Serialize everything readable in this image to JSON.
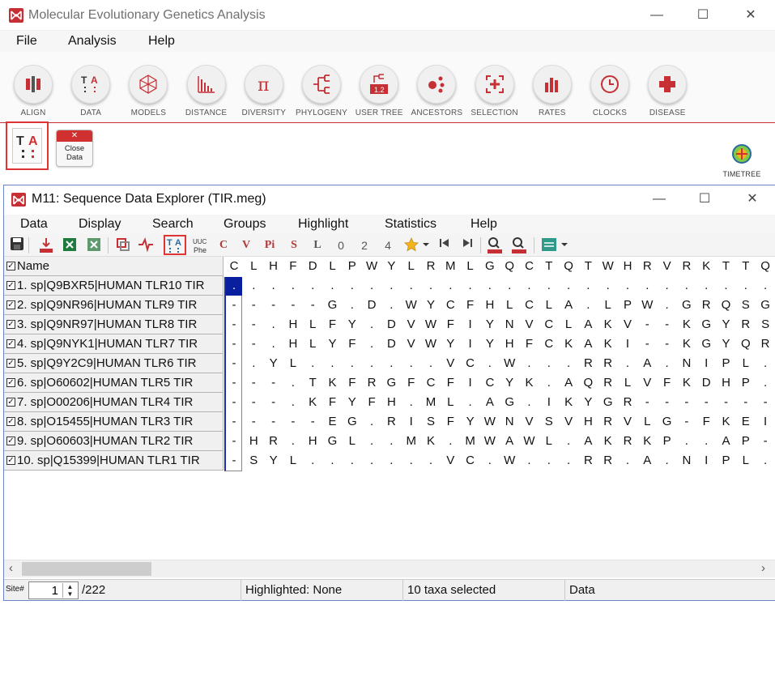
{
  "main_window": {
    "title": "Molecular Evolutionary Genetics Analysis",
    "menu": [
      "File",
      "Analysis",
      "Help"
    ],
    "tools": [
      {
        "label": "ALIGN",
        "icon": "align-icon"
      },
      {
        "label": "DATA",
        "icon": "data-icon"
      },
      {
        "label": "MODELS",
        "icon": "models-icon"
      },
      {
        "label": "DISTANCE",
        "icon": "distance-icon"
      },
      {
        "label": "DIVERSITY",
        "icon": "diversity-icon"
      },
      {
        "label": "PHYLOGENY",
        "icon": "phylogeny-icon"
      },
      {
        "label": "USER TREE",
        "icon": "user-tree-icon"
      },
      {
        "label": "ANCESTORS",
        "icon": "ancestors-icon"
      },
      {
        "label": "SELECTION",
        "icon": "selection-icon"
      },
      {
        "label": "RATES",
        "icon": "rates-icon"
      },
      {
        "label": "CLOCKS",
        "icon": "clocks-icon"
      },
      {
        "label": "DISEASE",
        "icon": "disease-icon"
      }
    ],
    "close_data_line1": "Close",
    "close_data_line2": "Data",
    "timetree_label": "TIMETREE"
  },
  "explorer": {
    "title": "M11: Sequence Data Explorer (TIR.meg)",
    "menu": [
      "Data",
      "Display",
      "Search",
      "Groups",
      "Highlight",
      "Statistics",
      "Help"
    ],
    "toolbar_letters": [
      "C",
      "V",
      "Pi",
      "S",
      "L",
      "0",
      "2",
      "4"
    ],
    "name_header": "Name",
    "header_chars": "CLHFDLPWYLRMLGQCTQTWHRVRKTTQEC",
    "taxa": [
      {
        "name": "1. sp|Q9BXR5|HUMAN TLR10 TIR",
        "seq": ". . . . . . . . . . . . . . . . . . . . . . . . . . . . "
      },
      {
        "name": "2. sp|Q9NR96|HUMAN TLR9 TIR",
        "seq": "-----G.D.WYCFHLCLA.LPW.GRQSGR"
      },
      {
        "name": "3. sp|Q9NR97|HUMAN TLR8 TIR",
        "seq": "--.HLFY.DVWFIYNVCLAKV--KGYRSLS"
      },
      {
        "name": "4. sp|Q9NYK1|HUMAN TLR7 TIR",
        "seq": "--.HLYF.DVWYIYHFCKAKI--KGYQRLI"
      },
      {
        "name": "5. sp|Q9Y2C9|HUMAN TLR6 TIR",
        "seq": "-.YL.......VC.W...RR.A.NIPL.E"
      },
      {
        "name": "6. sp|O60602|HUMAN TLR5 TIR",
        "seq": "---.TKFRGFCFICYK.AQRLVFKDHP.GT"
      },
      {
        "name": "7. sp|O00206|HUMAN TLR4 TIR",
        "seq": "---.KFYFH.ML.AG.IKYGR---------"
      },
      {
        "name": "8. sp|O15455|HUMAN TLR3 TIR",
        "seq": "-----EG.RISFYWNVSVHRVLG-FKEIDR"
      },
      {
        "name": "9. sp|O60603|HUMAN TLR2 TIR",
        "seq": "-HR.HGL..MK.MWAWL.AKRKP..AP---"
      },
      {
        "name": "10. sp|Q15399|HUMAN TLR1 TIR",
        "seq": "-SYL.......VC.W...RR.A.NIPL.E"
      }
    ],
    "status": {
      "site_label": "Site#",
      "site_value": "1",
      "site_total": "/222",
      "highlighted": "Highlighted: None",
      "selected": "10 taxa selected",
      "mode": "Data"
    }
  },
  "colors": {
    "brand_red": "#c62f34",
    "selection_blue": "#0a1ea0",
    "star_yellow": "#f2b31b"
  }
}
